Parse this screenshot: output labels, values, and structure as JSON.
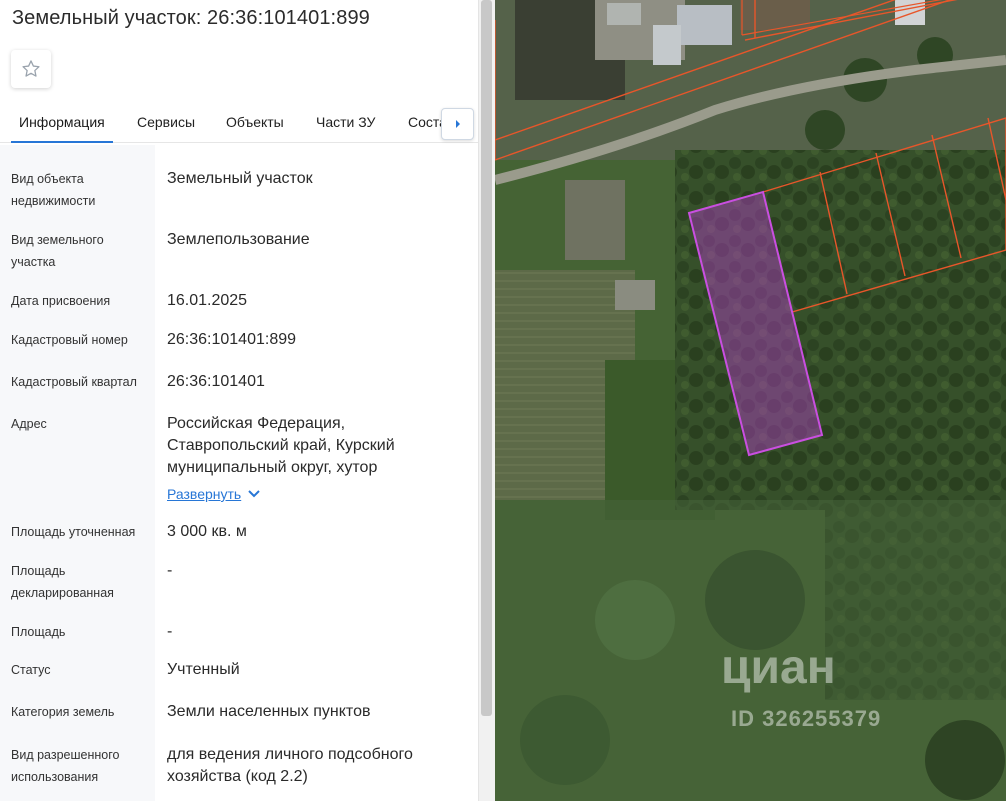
{
  "header": {
    "title": "Земельный участок: 26:36:101401:899"
  },
  "tabs": [
    {
      "label": "Информация"
    },
    {
      "label": "Сервисы"
    },
    {
      "label": "Объекты"
    },
    {
      "label": "Части ЗУ"
    },
    {
      "label": "Соста"
    }
  ],
  "info": [
    {
      "label": "Вид объекта недвижимости",
      "value": "Земельный участок"
    },
    {
      "label": "Вид земельного участка",
      "value": "Землепользование"
    },
    {
      "label": "Дата присвоения",
      "value": "16.01.2025"
    },
    {
      "label": "Кадастровый номер",
      "value": "26:36:101401:899"
    },
    {
      "label": "Кадастровый квартал",
      "value": "26:36:101401"
    },
    {
      "label": "Адрес",
      "value": "Российская Федерация, Ставропольский край, Курский муниципальный округ, хутор",
      "link": "Развернуть"
    },
    {
      "label": "Площадь уточненная",
      "value": "3 000 кв. м"
    },
    {
      "label": "Площадь декларированная",
      "value": "-"
    },
    {
      "label": "Площадь",
      "value": "-"
    },
    {
      "label": "Статус",
      "value": "Учтенный"
    },
    {
      "label": "Категория земель",
      "value": "Земли населенных пунктов"
    },
    {
      "label": "Вид разрешенного использования",
      "value": "для ведения личного подсобного хозяйства (код 2.2)"
    }
  ],
  "map": {
    "watermark_brand": "циан",
    "watermark_id": "ID 326255379",
    "colors": {
      "parcel_highlight": "#b43cc8",
      "parcel_border": "#e8562a",
      "vegetation": "#3f5a2c"
    }
  },
  "icons": {
    "favorite": "star-outline-icon",
    "next_tab": "chevron-right-icon",
    "expand": "chevron-down-icon"
  }
}
